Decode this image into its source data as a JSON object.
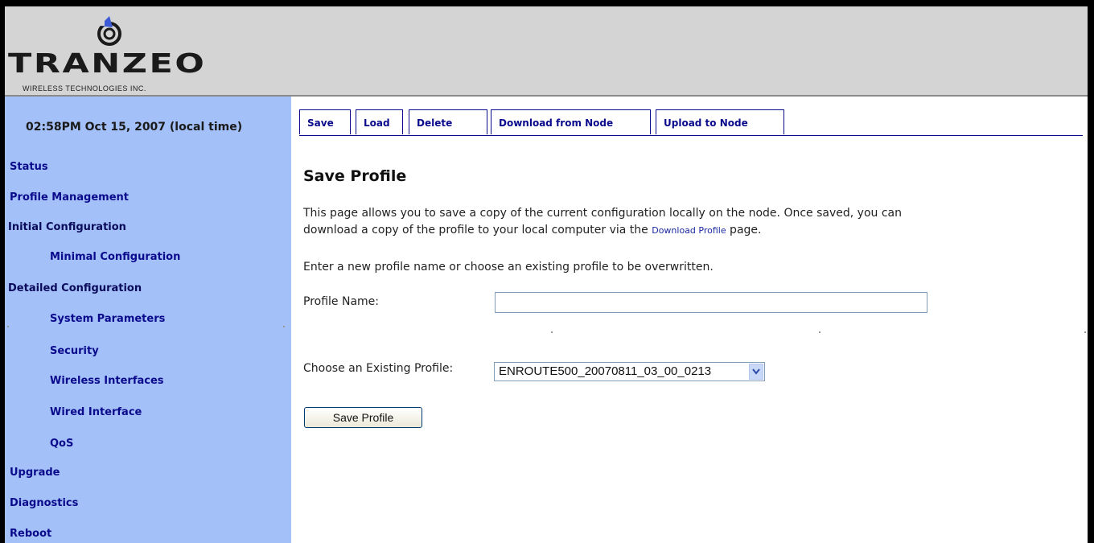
{
  "header": {
    "logo_word": "TRANZEO",
    "logo_sub": "WIRELESS TECHNOLOGIES INC."
  },
  "sidebar": {
    "time": "02:58PM Oct 15, 2007 (local time)",
    "items": [
      {
        "label": "Status"
      },
      {
        "label": "Profile Management"
      },
      {
        "label": "Initial Configuration"
      },
      {
        "label": "Minimal Configuration"
      },
      {
        "label": "Detailed Configuration"
      },
      {
        "label": "System Parameters"
      },
      {
        "label": "Security"
      },
      {
        "label": "Wireless Interfaces"
      },
      {
        "label": "Wired Interface"
      },
      {
        "label": "QoS"
      },
      {
        "label": "Upgrade"
      },
      {
        "label": "Diagnostics"
      },
      {
        "label": "Reboot"
      }
    ]
  },
  "tabs": [
    {
      "label": "Save"
    },
    {
      "label": "Load"
    },
    {
      "label": "Delete"
    },
    {
      "label": "Download from Node"
    },
    {
      "label": "Upload to Node"
    }
  ],
  "main": {
    "title": "Save Profile",
    "intro_1": "This page allows you to save a copy of the current configuration locally on the node. Once saved, you can",
    "intro_2a": "download a copy of the profile to your local computer via the ",
    "intro_link": "Download Profile",
    "intro_2b": " page.",
    "instruction": "Enter a new profile name or choose an existing profile to be overwritten.",
    "profile_name_label": "Profile Name:",
    "profile_name_value": "",
    "existing_label": "Choose an Existing Profile:",
    "existing_selected": "ENROUTE500_20070811_03_00_0213",
    "save_button": "Save Profile"
  },
  "colors": {
    "sidebar_bg": "#a4c0f8",
    "header_bg": "#d4d4d4",
    "link": "#0a0a8c",
    "logo_accent": "#3b5bd6"
  }
}
